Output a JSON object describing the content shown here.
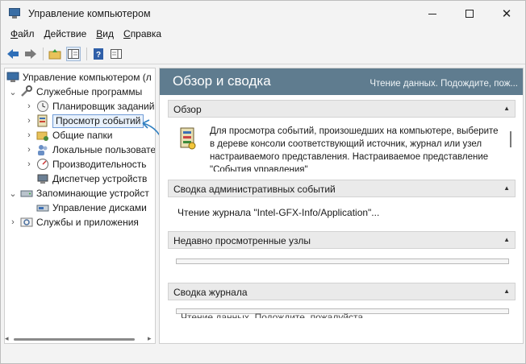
{
  "window": {
    "title": "Управление компьютером",
    "minimize_icon": "minimize-icon",
    "maximize_icon": "maximize-icon",
    "close_icon": "close-icon",
    "close_glyph": "✕"
  },
  "menu": {
    "items": [
      {
        "label": "Файл"
      },
      {
        "label": "Действие"
      },
      {
        "label": "Вид"
      },
      {
        "label": "Справка"
      }
    ]
  },
  "toolbar": {
    "buttons": [
      "back-icon",
      "forward-icon",
      "up-folder-icon",
      "show-hide-tree-icon",
      "help-icon",
      "console-pane-icon"
    ]
  },
  "tree": {
    "root": "Управление компьютером (л",
    "items": [
      {
        "label": "Служебные программы",
        "expanded": true
      },
      {
        "label": "Планировщик заданий"
      },
      {
        "label": "Просмотр событий",
        "selected": true
      },
      {
        "label": "Общие папки"
      },
      {
        "label": "Локальные пользовате"
      },
      {
        "label": "Производительность"
      },
      {
        "label": "Диспетчер устройств"
      },
      {
        "label": "Запоминающие устройст",
        "expanded": true
      },
      {
        "label": "Управление дисками"
      },
      {
        "label": "Службы и приложения"
      }
    ]
  },
  "main": {
    "title": "Обзор и сводка",
    "status": "Чтение данных. Подождите, пож...",
    "sections": [
      {
        "label": "Обзор"
      },
      {
        "label": "Сводка административных событий"
      },
      {
        "label": "Недавно просмотренные узлы"
      },
      {
        "label": "Сводка журнала"
      }
    ],
    "overview_text": "Для просмотра событий, произошедших на компьютере, выберите в дереве консоли соответствующий источник, журнал или узел настраиваемого представления. Настраиваемое представление \"События управления\"",
    "admin_events_text": "Чтение журнала \"Intel-GFX-Info/Application\"...",
    "log_summary_text": "Чтение данных. Подождите, пожалуйста..."
  },
  "colors": {
    "header_bg": "#5f7c8f",
    "selection_border": "#6e9bd6",
    "annotation": "#2f7fc1"
  }
}
